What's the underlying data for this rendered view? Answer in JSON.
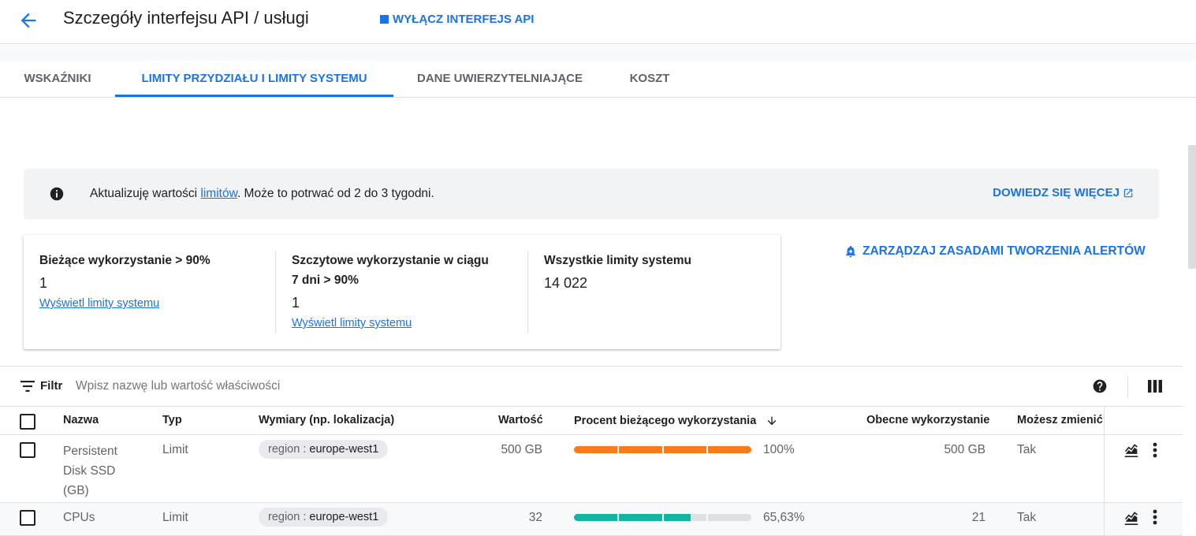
{
  "header": {
    "title": "Szczegóły interfejsu API / usługi",
    "disable_api_label": "WYŁĄCZ INTERFEJS API"
  },
  "tabs": [
    {
      "label": "WSKAŹNIKI",
      "active": false
    },
    {
      "label": "LIMITY PRZYDZIAŁU I LIMITY SYSTEMU",
      "active": true
    },
    {
      "label": "DANE UWIERZYTELNIAJĄCE",
      "active": false
    },
    {
      "label": "KOSZT",
      "active": false
    }
  ],
  "banner": {
    "text_before": "Aktualizuję wartości ",
    "link_text": "limitów",
    "text_after": ". Może to potrwać od 2 do 3 tygodni.",
    "learn_more": "DOWIEDZ SIĘ WIĘCEJ"
  },
  "summary": {
    "current_usage": {
      "label": "Bieżące wykorzystanie > 90%",
      "value": "1",
      "link": "Wyświetl limity systemu"
    },
    "peak_usage": {
      "label_line1": "Szczytowe wykorzystanie w ciągu",
      "label_line2": "7 dni > 90%",
      "value": "1",
      "link": "Wyświetl limity systemu"
    },
    "all_limits": {
      "label": "Wszystkie limity systemu",
      "value": "14 022"
    }
  },
  "alert_button": "ZARZĄDZAJ ZASADAMI TWORZENIA ALERTÓW",
  "filter": {
    "label": "Filtr",
    "placeholder": "Wpisz nazwę lub wartość właściwości"
  },
  "table": {
    "headers": {
      "name": "Nazwa",
      "type": "Typ",
      "dimensions": "Wymiary (np. lokalizacja)",
      "value": "Wartość",
      "percent": "Procent bieżącego wykorzystania",
      "current": "Obecne wykorzystanie",
      "adjustable": "Możesz zmienić"
    },
    "rows": [
      {
        "name_lines": [
          "Persistent",
          "Disk SSD",
          "(GB)"
        ],
        "type": "Limit",
        "dim_key": "region : ",
        "dim_value": "europe-west1",
        "value": "500 GB",
        "percent_fraction": 1.0,
        "percent_label": "100%",
        "current": "500 GB",
        "adjustable": "Tak",
        "bar_color": "#fa7b17"
      },
      {
        "name_lines": [
          "CPUs"
        ],
        "type": "Limit",
        "dim_key": "region : ",
        "dim_value": "europe-west1",
        "value": "32",
        "percent_fraction": 0.6563,
        "percent_label": "65,63%",
        "current": "21",
        "adjustable": "Tak",
        "bar_color": "#12b5a0"
      }
    ]
  },
  "colors": {
    "accent": "#1a73e8",
    "bar_track": "#e0e0e0"
  }
}
